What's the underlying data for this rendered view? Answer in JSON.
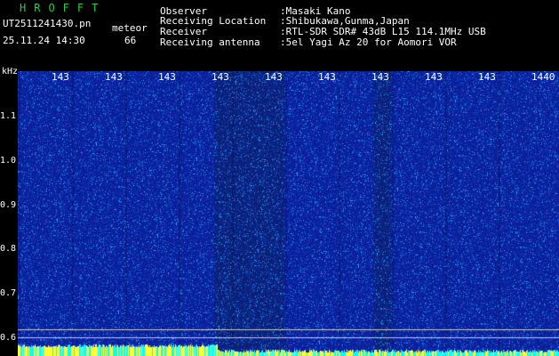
{
  "header": {
    "title": "HROFFT",
    "filename": "UT2511241430.pn",
    "meteor_label": "meteor",
    "date_time": "25.11.24 14:30",
    "meteor_count": "66"
  },
  "info": [
    {
      "key": "Observer",
      "value": ":Masaki Kano"
    },
    {
      "key": "Receiving Location",
      "value": ":Shibukawa,Gunma,Japan"
    },
    {
      "key": "Receiver",
      "value": ":RTL-SDR SDR# 43dB L15 114.1MHz USB"
    },
    {
      "key": "Receiving antenna",
      "value": ":5el Yagi Az 20 for Aomori VOR"
    }
  ],
  "axis": {
    "y_unit": "kHz",
    "y_ticks": [
      "1.1",
      "1.0",
      "0.9",
      "0.8",
      "0.7",
      "0.6"
    ],
    "x_ticks": [
      "143",
      "143",
      "143",
      "143",
      "143",
      "143",
      "143",
      "143",
      "143",
      "1440"
    ]
  },
  "colors": {
    "background": "#000000",
    "spectrogram_base": "#0a1f9e",
    "title": "#2ecc40",
    "bottom_bar": "#00ffff"
  }
}
